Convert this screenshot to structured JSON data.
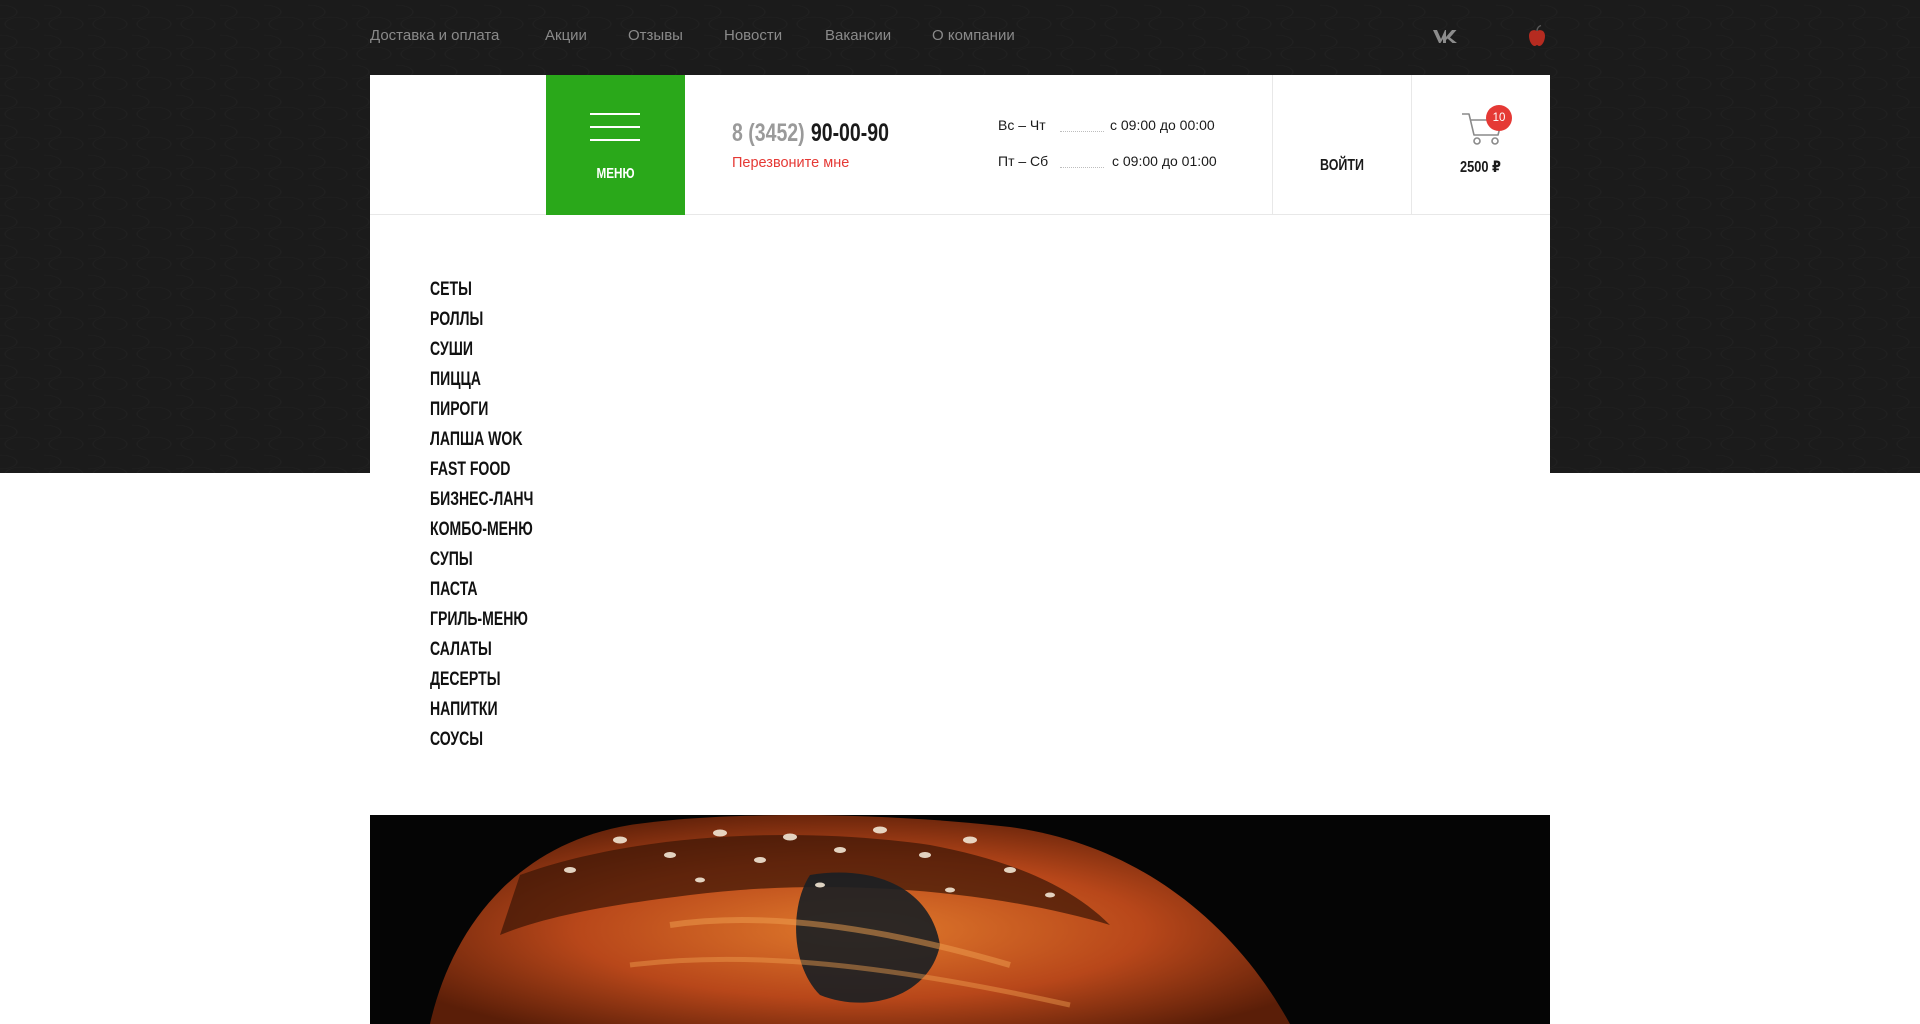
{
  "topnav": [
    {
      "label": "Доставка и оплата"
    },
    {
      "label": "Акции"
    },
    {
      "label": "Отзывы"
    },
    {
      "label": "Новости"
    },
    {
      "label": "Вакансии"
    },
    {
      "label": "О компании"
    }
  ],
  "social": {
    "vk_label": "vk"
  },
  "header": {
    "menu_label": "МЕНЮ",
    "phone_code": "8 (3452)",
    "phone_number": "90-00-90",
    "callback_label": "Перезвоните мне",
    "hours": [
      {
        "days": "Вс – Чт",
        "time": "с 09:00 до 00:00"
      },
      {
        "days": "Пт – Сб",
        "time": "с 09:00 до 01:00"
      }
    ],
    "login_label": "ВОЙТИ",
    "cart_count": "10",
    "cart_total": "2500 ₽"
  },
  "categories": [
    "СЕТЫ",
    "РОЛЛЫ",
    "СУШИ",
    "ПИЦЦА",
    "ПИРОГИ",
    "ЛАПША WOK",
    "FAST FOOD",
    "БИЗНЕС-ЛАНЧ",
    "КОМБО-МЕНЮ",
    "СУПЫ",
    "ПАСТА",
    "ГРИЛЬ-МЕНЮ",
    "САЛАТЫ",
    "ДЕСЕРТЫ",
    "НАПИТКИ",
    "СОУСЫ"
  ],
  "colors": {
    "accent_green": "#2aa81a",
    "accent_red": "#e53935",
    "dark_bg": "#1b1b1b"
  },
  "icons": [
    "vk-icon",
    "apple-icon",
    "hamburger-icon",
    "cart-icon"
  ]
}
